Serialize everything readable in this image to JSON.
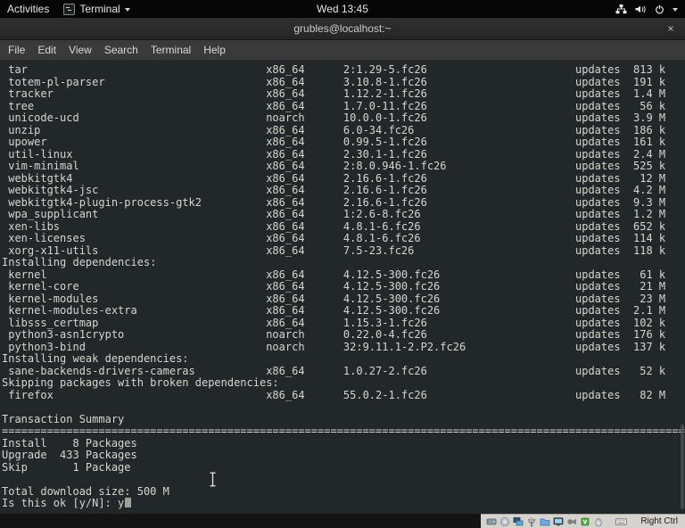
{
  "top_bar": {
    "activities_label": "Activities",
    "app_menu_label": "Terminal",
    "clock": "Wed 13:45"
  },
  "window": {
    "title": "grubles@localhost:~",
    "close_glyph": "×"
  },
  "menu_bar": {
    "items": [
      "File",
      "Edit",
      "View",
      "Search",
      "Terminal",
      "Help"
    ]
  },
  "terminal": {
    "colors": {
      "background": "#222829",
      "foreground": "#d3d7cf"
    },
    "layout": {
      "name_w": 40,
      "arch_w": 12,
      "ver_w": 36,
      "repo_w": 7,
      "size_w": 7,
      "sep_len": 106
    },
    "entries": [
      {
        "t": "pkg",
        "name": "tar",
        "arch": "x86_64",
        "version": "2:1.29-5.fc26",
        "repo": "updates",
        "size": "813 k"
      },
      {
        "t": "pkg",
        "name": "totem-pl-parser",
        "arch": "x86_64",
        "version": "3.10.8-1.fc26",
        "repo": "updates",
        "size": "191 k"
      },
      {
        "t": "pkg",
        "name": "tracker",
        "arch": "x86_64",
        "version": "1.12.2-1.fc26",
        "repo": "updates",
        "size": "1.4 M"
      },
      {
        "t": "pkg",
        "name": "tree",
        "arch": "x86_64",
        "version": "1.7.0-11.fc26",
        "repo": "updates",
        "size": "56 k"
      },
      {
        "t": "pkg",
        "name": "unicode-ucd",
        "arch": "noarch",
        "version": "10.0.0-1.fc26",
        "repo": "updates",
        "size": "3.9 M"
      },
      {
        "t": "pkg",
        "name": "unzip",
        "arch": "x86_64",
        "version": "6.0-34.fc26",
        "repo": "updates",
        "size": "186 k"
      },
      {
        "t": "pkg",
        "name": "upower",
        "arch": "x86_64",
        "version": "0.99.5-1.fc26",
        "repo": "updates",
        "size": "161 k"
      },
      {
        "t": "pkg",
        "name": "util-linux",
        "arch": "x86_64",
        "version": "2.30.1-1.fc26",
        "repo": "updates",
        "size": "2.4 M"
      },
      {
        "t": "pkg",
        "name": "vim-minimal",
        "arch": "x86_64",
        "version": "2:8.0.946-1.fc26",
        "repo": "updates",
        "size": "525 k"
      },
      {
        "t": "pkg",
        "name": "webkitgtk4",
        "arch": "x86_64",
        "version": "2.16.6-1.fc26",
        "repo": "updates",
        "size": "12 M"
      },
      {
        "t": "pkg",
        "name": "webkitgtk4-jsc",
        "arch": "x86_64",
        "version": "2.16.6-1.fc26",
        "repo": "updates",
        "size": "4.2 M"
      },
      {
        "t": "pkg",
        "name": "webkitgtk4-plugin-process-gtk2",
        "arch": "x86_64",
        "version": "2.16.6-1.fc26",
        "repo": "updates",
        "size": "9.3 M"
      },
      {
        "t": "pkg",
        "name": "wpa_supplicant",
        "arch": "x86_64",
        "version": "1:2.6-8.fc26",
        "repo": "updates",
        "size": "1.2 M"
      },
      {
        "t": "pkg",
        "name": "xen-libs",
        "arch": "x86_64",
        "version": "4.8.1-6.fc26",
        "repo": "updates",
        "size": "652 k"
      },
      {
        "t": "pkg",
        "name": "xen-licenses",
        "arch": "x86_64",
        "version": "4.8.1-6.fc26",
        "repo": "updates",
        "size": "114 k"
      },
      {
        "t": "pkg",
        "name": "xorg-x11-utils",
        "arch": "x86_64",
        "version": "7.5-23.fc26",
        "repo": "updates",
        "size": "118 k"
      },
      {
        "t": "text",
        "text": "Installing dependencies:"
      },
      {
        "t": "pkg",
        "name": "kernel",
        "arch": "x86_64",
        "version": "4.12.5-300.fc26",
        "repo": "updates",
        "size": "61 k"
      },
      {
        "t": "pkg",
        "name": "kernel-core",
        "arch": "x86_64",
        "version": "4.12.5-300.fc26",
        "repo": "updates",
        "size": "21 M"
      },
      {
        "t": "pkg",
        "name": "kernel-modules",
        "arch": "x86_64",
        "version": "4.12.5-300.fc26",
        "repo": "updates",
        "size": "23 M"
      },
      {
        "t": "pkg",
        "name": "kernel-modules-extra",
        "arch": "x86_64",
        "version": "4.12.5-300.fc26",
        "repo": "updates",
        "size": "2.1 M"
      },
      {
        "t": "pkg",
        "name": "libsss_certmap",
        "arch": "x86_64",
        "version": "1.15.3-1.fc26",
        "repo": "updates",
        "size": "102 k"
      },
      {
        "t": "pkg",
        "name": "python3-asn1crypto",
        "arch": "noarch",
        "version": "0.22.0-4.fc26",
        "repo": "updates",
        "size": "176 k"
      },
      {
        "t": "pkg",
        "name": "python3-bind",
        "arch": "noarch",
        "version": "32:9.11.1-2.P2.fc26",
        "repo": "updates",
        "size": "137 k"
      },
      {
        "t": "text",
        "text": "Installing weak dependencies:"
      },
      {
        "t": "pkg",
        "name": "sane-backends-drivers-cameras",
        "arch": "x86_64",
        "version": "1.0.27-2.fc26",
        "repo": "updates",
        "size": "52 k"
      },
      {
        "t": "text",
        "text": "Skipping packages with broken dependencies:"
      },
      {
        "t": "pkg",
        "name": "firefox",
        "arch": "x86_64",
        "version": "55.0.2-1.fc26",
        "repo": "updates",
        "size": "82 M"
      },
      {
        "t": "blank"
      },
      {
        "t": "text",
        "text": "Transaction Summary"
      },
      {
        "t": "sep"
      },
      {
        "t": "text",
        "text": "Install    8 Packages"
      },
      {
        "t": "text",
        "text": "Upgrade  433 Packages"
      },
      {
        "t": "text",
        "text": "Skip       1 Package"
      },
      {
        "t": "blank"
      },
      {
        "t": "text",
        "text": "Total download size: 500 M"
      },
      {
        "t": "text",
        "text": "Is this ok [y/N]: y",
        "cursor": true
      }
    ]
  },
  "status_bar": {
    "host_key": "Right Ctrl",
    "panel_bg": "#d6d2cd",
    "icons": [
      "hard-disk",
      "optical-disk",
      "network",
      "usb",
      "shared-folders",
      "display",
      "recording",
      "features",
      "mouse",
      "keyboard"
    ]
  }
}
